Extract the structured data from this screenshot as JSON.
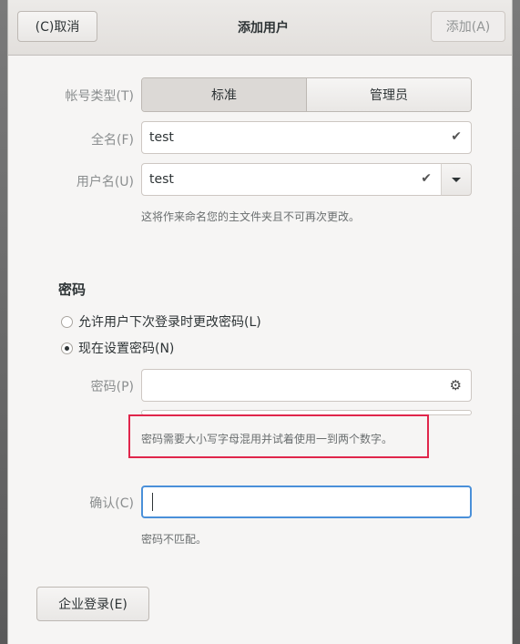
{
  "header": {
    "cancel_label": "(C)取消",
    "title": "添加用户",
    "add_label": "添加(A)"
  },
  "account_type": {
    "label": "帐号类型(T)",
    "options": [
      "标准",
      "管理员"
    ],
    "selected": "标准"
  },
  "full_name": {
    "label": "全名(F)",
    "value": "test"
  },
  "username": {
    "label": "用户名(U)",
    "value": "test",
    "hint": "这将作来命名您的主文件夹且不可再次更改。"
  },
  "password_section": {
    "title": "密码",
    "radio_later": "允许用户下次登录时更改密码(L)",
    "radio_now": "现在设置密码(N)",
    "selected": "now",
    "password_label": "密码(P)",
    "password_value": "",
    "password_hint": "密码需要大小写字母混用并试着使用一到两个数字。",
    "confirm_label": "确认(C)",
    "confirm_value": "",
    "confirm_hint": "密码不匹配。"
  },
  "enterprise_label": "企业登录(E)",
  "icons": {
    "check": "check-icon",
    "dropdown": "chevron-down-icon",
    "generate": "gear-icon"
  },
  "colors": {
    "highlight_box": "#e0264b",
    "focus": "#4a90d9"
  }
}
